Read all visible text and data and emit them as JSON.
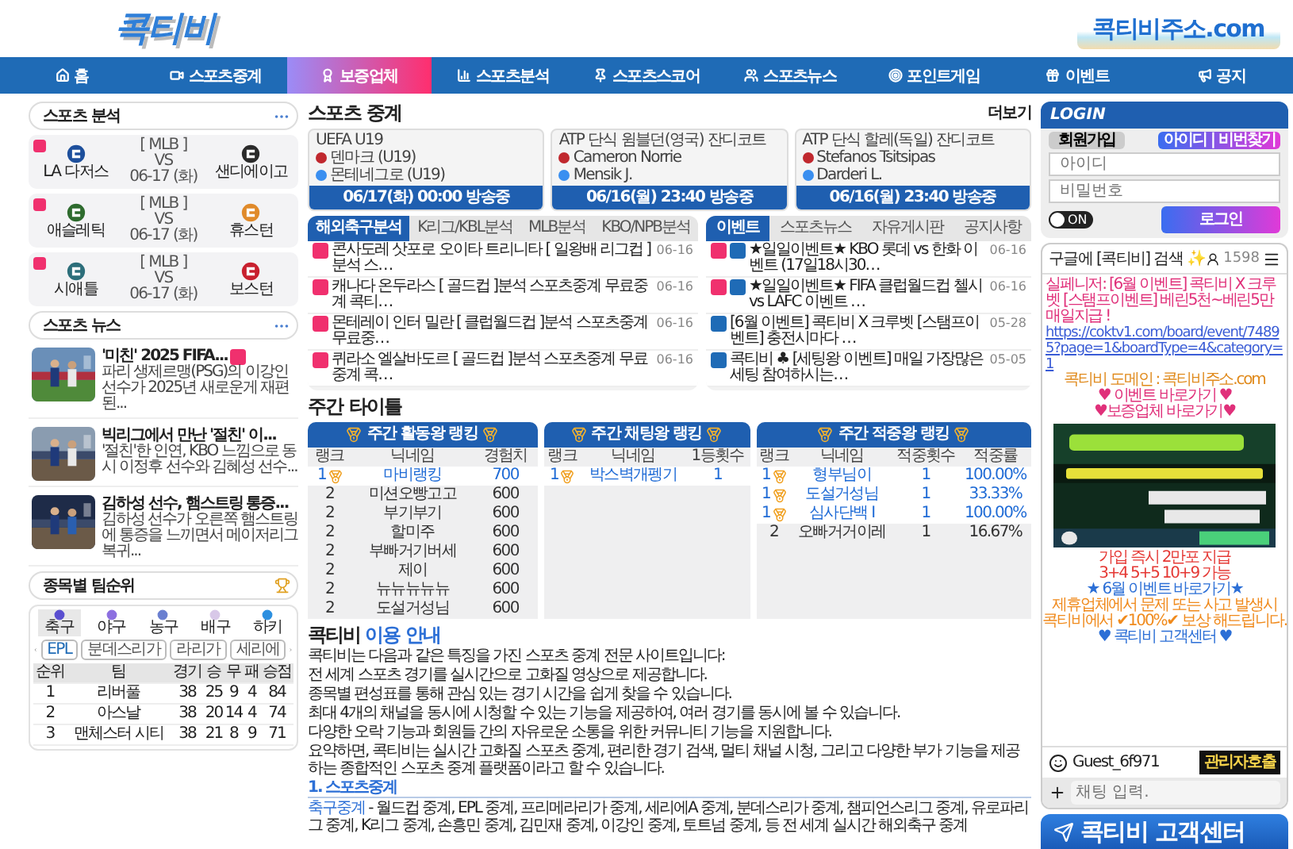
{
  "header": {
    "logo": "콕티비",
    "address_logo": "콕티비주소.com"
  },
  "nav": [
    {
      "label": "홈",
      "selected": false
    },
    {
      "label": "스포츠중계",
      "selected": false
    },
    {
      "label": "보증업체",
      "selected": true
    },
    {
      "label": "스포츠분석",
      "selected": false
    },
    {
      "label": "스포츠스코어",
      "selected": false
    },
    {
      "label": "스포츠뉴스",
      "selected": false
    },
    {
      "label": "포인트게임",
      "selected": false
    },
    {
      "label": "이벤트",
      "selected": false
    },
    {
      "label": "공지",
      "selected": false
    }
  ],
  "analysis": {
    "title": "스포츠 분석",
    "matches": [
      {
        "league": "[ MLB ]",
        "vs": "VS",
        "date": "06-17 (화)",
        "home": "LA 다저스",
        "away": "샌디에이고"
      },
      {
        "league": "[ MLB ]",
        "vs": "VS",
        "date": "06-17 (화)",
        "home": "애슬레틱",
        "away": "휴스턴"
      },
      {
        "league": "[ MLB ]",
        "vs": "VS",
        "date": "06-17 (화)",
        "home": "시애틀",
        "away": "보스턴"
      }
    ]
  },
  "news": {
    "title": "스포츠 뉴스",
    "items": [
      {
        "title": "'미친' 2025 FIFA...",
        "new": true,
        "summary": "파리 생제르맹(PSG)의 이강인 선수가 2025년 새로운게 재편된..."
      },
      {
        "title": "빅리그에서 만난 '절친' 이...",
        "new": false,
        "summary": "'절친'한 인연, KBO 느낌으로 동시 이정후 선수와 김혜성 선수..."
      },
      {
        "title": "김하성 선수, 햄스트링 통증...",
        "new": false,
        "summary": "김하성 선수가 오른쪽 햄스트링에 통증을 느끼면서 메이저리그 복귀..."
      }
    ]
  },
  "standings": {
    "title": "종목별 팀순위",
    "sports": [
      {
        "label": "축구",
        "selected": true
      },
      {
        "label": "야구",
        "selected": false
      },
      {
        "label": "농구",
        "selected": false
      },
      {
        "label": "배구",
        "selected": false
      },
      {
        "label": "하키",
        "selected": false
      }
    ],
    "leagues": [
      {
        "label": "EPL",
        "selected": true
      },
      {
        "label": "분데스리가",
        "selected": false
      },
      {
        "label": "라리가",
        "selected": false
      },
      {
        "label": "세리에",
        "selected": false
      }
    ],
    "columns": [
      "순위",
      "팀",
      "경기",
      "승",
      "무",
      "패",
      "승점"
    ],
    "rows": [
      [
        "1",
        "리버풀",
        "38",
        "25",
        "9",
        "4",
        "84"
      ],
      [
        "2",
        "아스날",
        "38",
        "20",
        "14",
        "4",
        "74"
      ],
      [
        "3",
        "맨체스터 시티",
        "38",
        "21",
        "8",
        "9",
        "71"
      ]
    ]
  },
  "broadcast": {
    "title": "스포츠 중계",
    "more": "더보기",
    "games": [
      {
        "league": "UEFA U19",
        "home": "덴마크 (U19)",
        "away": "몬테네그로 (U19)",
        "time": "06/17(화) 00:00 방송중"
      },
      {
        "league": "ATP 단식 윔블던(영국) 잔디코트",
        "home": "Cameron Norrie",
        "away": "Mensik J.",
        "time": "06/16(월) 23:40 방송중"
      },
      {
        "league": "ATP 단식 할레(독일) 잔디코트",
        "home": "Stefanos Tsitsipas",
        "away": "Darderi L.",
        "time": "06/16(월) 23:40 방송중"
      }
    ]
  },
  "boards": [
    {
      "tabs": [
        {
          "label": "해외축구분석",
          "selected": true
        },
        {
          "label": "K리그/KBL분석",
          "selected": false
        },
        {
          "label": "MLB분석",
          "selected": false
        },
        {
          "label": "KBO/NPB분석",
          "selected": false
        }
      ],
      "posts": [
        {
          "new": true,
          "hot": false,
          "title": "콘사도레 삿포로 오이타 트리니타 [ 일왕배 리그컵 ]분석 스…",
          "date": "06-16"
        },
        {
          "new": true,
          "hot": false,
          "title": "캐나다 온두라스 [ 골드컵 ]분석 스포츠중계 무료중계 콕티…",
          "date": "06-16"
        },
        {
          "new": true,
          "hot": false,
          "title": "몬테레이 인터 밀란 [ 클럽월드컵 ]분석 스포츠중계 무료중…",
          "date": "06-16"
        },
        {
          "new": true,
          "hot": false,
          "title": "퀴라소 엘살바도르 [ 골드컵 ]분석 스포츠중계 무료중계 콕…",
          "date": "06-16"
        }
      ]
    },
    {
      "tabs": [
        {
          "label": "이벤트",
          "selected": true
        },
        {
          "label": "스포츠뉴스",
          "selected": false
        },
        {
          "label": "자유게시판",
          "selected": false
        },
        {
          "label": "공지사항",
          "selected": false
        }
      ],
      "posts": [
        {
          "new": true,
          "hot": true,
          "title": "★일일이벤트★ KBO 롯데 vs 한화 이벤트 (17일18시30…",
          "date": "06-16"
        },
        {
          "new": true,
          "hot": true,
          "title": "★일일이벤트★ FIFA 클럽월드컵 첼시 vs LAFC 이벤트 …",
          "date": "06-16"
        },
        {
          "new": false,
          "hot": true,
          "title": "[6월 이벤트] 콕티비 X 크루벳 [스탬프이벤트] 충전시마다 …",
          "date": "05-28"
        },
        {
          "new": false,
          "hot": true,
          "title": "콕티비 ♣ [세팅왕 이벤트] 매일 가장많은 세팅 참여하시는…",
          "date": "05-05"
        }
      ]
    }
  ],
  "weekly": {
    "title": "주간 타이틀",
    "rankings": [
      {
        "title": "주간 활동왕 랭킹",
        "columns": [
          "랭크",
          "닉네임",
          "경험치"
        ],
        "rows": [
          {
            "medal": true,
            "cells": [
              "1",
              "마비랭킹",
              "700"
            ]
          },
          {
            "medal": false,
            "cells": [
              "2",
              "미션오빵고고",
              "600"
            ]
          },
          {
            "medal": false,
            "cells": [
              "2",
              "부기부기",
              "600"
            ]
          },
          {
            "medal": false,
            "cells": [
              "2",
              "할미주",
              "600"
            ]
          },
          {
            "medal": false,
            "cells": [
              "2",
              "부빠거기버세",
              "600"
            ]
          },
          {
            "medal": false,
            "cells": [
              "2",
              "제이",
              "600"
            ]
          },
          {
            "medal": false,
            "cells": [
              "2",
              "뉴뉴뉴뉴뉴",
              "600"
            ]
          },
          {
            "medal": false,
            "cells": [
              "2",
              "도설거성님",
              "600"
            ]
          }
        ]
      },
      {
        "title": "주간 채팅왕 랭킹",
        "columns": [
          "랭크",
          "닉네임",
          "1등횟수"
        ],
        "rows": [
          {
            "medal": true,
            "cells": [
              "1",
              "박스벽개펭기",
              "1"
            ]
          }
        ]
      },
      {
        "title": "주간 적중왕 랭킹",
        "columns": [
          "랭크",
          "닉네임",
          "적중횟수",
          "적중률"
        ],
        "rows": [
          {
            "medal": true,
            "cells": [
              "1",
              "형부님이",
              "1",
              "100.00%"
            ]
          },
          {
            "medal": true,
            "cells": [
              "1",
              "도설거성님",
              "1",
              "33.33%"
            ]
          },
          {
            "medal": true,
            "cells": [
              "1",
              "심사단백 I",
              "1",
              "100.00%"
            ]
          },
          {
            "medal": false,
            "cells": [
              "2",
              "오빠거거이레",
              "1",
              "16.67%"
            ]
          }
        ]
      }
    ]
  },
  "guide": {
    "brand": "콕티비",
    "title": "이용 안내",
    "intro": "콕티비는 다음과 같은 특징을 가진 스포츠 중계 전문 사이트입니다:",
    "points": [
      "전 세계 스포츠 경기를 실시간으로 고화질 영상으로 제공합니다.",
      "종목별 편성표를 통해 관심 있는 경기 시간을 쉽게 찾을 수 있습니다.",
      "최대 4개의 채널을 동시에 시청할 수 있는 기능을 제공하여, 여러 경기를 동시에 볼 수 있습니다.",
      "다양한 오락 기능과 회원들 간의 자유로운 소통을 위한 커뮤니티 기능을 지원합니다."
    ],
    "summary": "요약하면, 콕티비는 실시간 고화질 스포츠 중계, 편리한 경기 검색, 멀티 채널 시청, 그리고 다양한 부가 기능을 제공하는 종합적인 스포츠 중계 플랫폼이라고 할 수 있습니다.",
    "heading": "1. 스포츠중계",
    "link": "축구중계",
    "text": " - 월드컵 중계, EPL 중계, 프리메라리가 중계, 세리에A 중계, 분데스리가 중계, 챔피언스리그 중계, 유로파리그 중계, K리그 중계, 손흥민 중계, 김민재 중계, 이강인 중계, 토트넘 중계, 등 전 세계 실시간 해외축구 중계"
  },
  "login": {
    "title": "LOGIN",
    "signup": "회원가입",
    "find": "아이디 | 비번찾기",
    "id_placeholder": "아이디",
    "pw_placeholder": "비밀번호",
    "toggle": {
      "label": "ON",
      "on": false
    },
    "submit": "로그인"
  },
  "chat": {
    "title": "구글에 [콕티비] 검색 ✨",
    "count": "1598",
    "messages": [
      {
        "kind": "notice",
        "text": "실페니저: [6월 이벤트] 콕티비 X 크루벳 [스탬프이벤트] 베린5천~베린5만 매일지급 !",
        "link": "https://coktv1.com/board/event/74895?page=1&boardType=4&category=1",
        "domain": "콕티비 도메인 : 콕티비주소.com"
      },
      {
        "kind": "line",
        "text": "♥ 이벤트 바로가기 ♥",
        "color": "#e0307a"
      },
      {
        "kind": "line",
        "text": "♥보증업체 바로가기♥",
        "color": "#e0307a"
      },
      {
        "kind": "picture"
      },
      {
        "kind": "line",
        "text": "가입 즉시 2만포 지급",
        "color": "#e53935"
      },
      {
        "kind": "line",
        "text": "3+4 5+5 10+9 가능",
        "color": "#e53935"
      },
      {
        "kind": "line",
        "text": "★ 6월 이벤트 바로가기★",
        "color": "#2c6fd6"
      },
      {
        "kind": "line",
        "text": "제휴업체에서 문제 또는 사고 발생시",
        "color": "#f08a1c"
      },
      {
        "kind": "line",
        "text": "콕티비에서 ✔100%✔ 보상 해드립니다.",
        "color": "#f08a1c"
      },
      {
        "kind": "line",
        "text": "♥ 콕티비 고객센터 ♥",
        "color": "#2c6fd6"
      }
    ],
    "guest": "Guest_6f971",
    "call": "관리자호출",
    "input_placeholder": "채팅 입력."
  },
  "support_banner": "콕티비 고객센터"
}
